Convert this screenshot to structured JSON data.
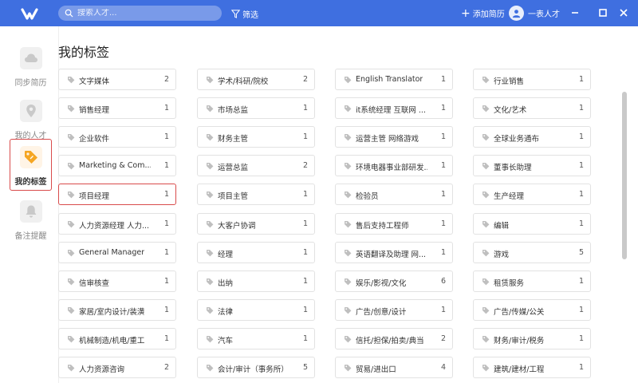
{
  "header": {
    "search_placeholder": "搜索人才...",
    "filter_label": "筛选",
    "add_resume_label": "添加简历",
    "user_name": "一表人才",
    "accent_color": "#3f6fe0"
  },
  "sidebar": {
    "items": [
      {
        "label": "同步简历",
        "icon": "cloud-icon"
      },
      {
        "label": "我的人才",
        "icon": "location-pin-icon"
      },
      {
        "label": "我的标签",
        "icon": "tag-icon",
        "active": true
      },
      {
        "label": "备注提醒",
        "icon": "bell-icon"
      }
    ]
  },
  "main": {
    "title": "我的标签",
    "tags": [
      {
        "name": "文字媒体",
        "count": "2"
      },
      {
        "name": "学术/科研/院校",
        "count": "2"
      },
      {
        "name": "English Translator",
        "count": "1"
      },
      {
        "name": "行业销售",
        "count": "1"
      },
      {
        "name": "销售经理",
        "count": "1"
      },
      {
        "name": "市场总监",
        "count": "1"
      },
      {
        "name": "it系统经理 互联网 ...",
        "count": "1"
      },
      {
        "name": "文化/艺术",
        "count": "1"
      },
      {
        "name": "企业软件",
        "count": "1"
      },
      {
        "name": "财务主管",
        "count": "1"
      },
      {
        "name": "运营主管 网络游戏",
        "count": "1"
      },
      {
        "name": "全球业务通布",
        "count": "1"
      },
      {
        "name": "Marketing & Com...",
        "count": "1"
      },
      {
        "name": "运营总监",
        "count": "2"
      },
      {
        "name": "环境电器事业部研发...",
        "count": "1"
      },
      {
        "name": "董事长助理",
        "count": "1"
      },
      {
        "name": "项目经理",
        "count": "1",
        "selected": true
      },
      {
        "name": "项目主管",
        "count": "1"
      },
      {
        "name": "检验员",
        "count": "1"
      },
      {
        "name": "生产经理",
        "count": "1"
      },
      {
        "name": "人力资源经理 人力...",
        "count": "1"
      },
      {
        "name": "大客户协调",
        "count": "1"
      },
      {
        "name": "售后支持工程师",
        "count": "1"
      },
      {
        "name": "编辑",
        "count": "1"
      },
      {
        "name": "General Manager",
        "count": "1"
      },
      {
        "name": "经理",
        "count": "1"
      },
      {
        "name": "英语翻译及助理 网...",
        "count": "1"
      },
      {
        "name": "游戏",
        "count": "5"
      },
      {
        "name": "信审核查",
        "count": "1"
      },
      {
        "name": "出纳",
        "count": "1"
      },
      {
        "name": "娱乐/影视/文化",
        "count": "6"
      },
      {
        "name": "租赁服务",
        "count": "1"
      },
      {
        "name": "家居/室内设计/装潢",
        "count": "1"
      },
      {
        "name": "法律",
        "count": "1"
      },
      {
        "name": "广告/创意/设计",
        "count": "1"
      },
      {
        "name": "广告/传媒/公关",
        "count": "1"
      },
      {
        "name": "机械制造/机电/重工",
        "count": "1"
      },
      {
        "name": "汽车",
        "count": "1"
      },
      {
        "name": "信托/担保/拍卖/典当",
        "count": "2"
      },
      {
        "name": "财务/审计/税务",
        "count": "1"
      },
      {
        "name": "人力资源咨询",
        "count": "2"
      },
      {
        "name": "会计/审计（事务所）",
        "count": "5"
      },
      {
        "name": "贸易/进出口",
        "count": "4"
      },
      {
        "name": "建筑/建材/工程",
        "count": "1"
      }
    ]
  }
}
